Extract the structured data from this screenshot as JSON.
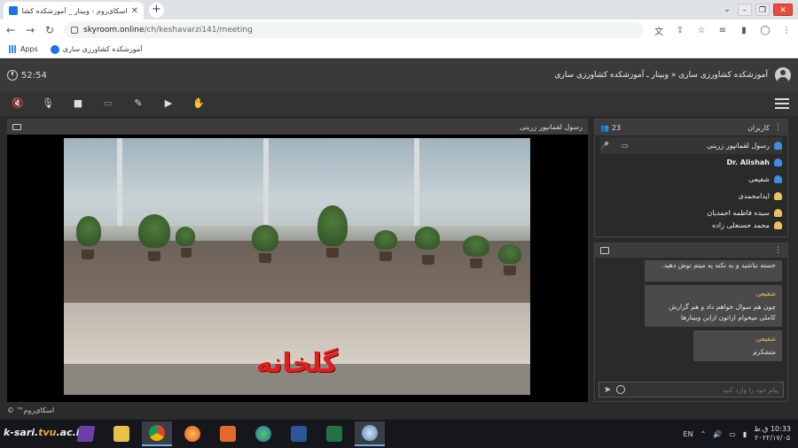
{
  "browser": {
    "tab_title": "اسکای‌روم - وبینار _ آموزشکده کشاورزی",
    "url_host": "skyroom.online",
    "url_path": "/ch/keshavarzi141/meeting",
    "bookmarks": [
      {
        "label": "Apps",
        "icon": "apps-grid-icon"
      },
      {
        "label": "آموزشکده کشاورزی ساری",
        "icon": "skyroom-icon"
      }
    ]
  },
  "meeting": {
    "timer": "52:54",
    "room_title": "آموزشکده کشاورزی ساری « وبینار ـ آموزشکده کشاورزی ساری",
    "toolbar": [
      {
        "name": "speaker-mute-icon",
        "glyph": "🔇"
      },
      {
        "name": "mic-off-icon",
        "glyph": "🎙"
      },
      {
        "name": "camera-icon",
        "glyph": "■"
      },
      {
        "name": "screen-share-icon",
        "glyph": "▭"
      },
      {
        "name": "brush-icon",
        "glyph": "✎"
      },
      {
        "name": "play-media-icon",
        "glyph": "▶"
      },
      {
        "name": "raise-hand-icon",
        "glyph": "✋"
      }
    ]
  },
  "video": {
    "speaker": "رسول لقمانپور زرینی",
    "caption": "گلخانه"
  },
  "users": {
    "label": "کاربران",
    "count": "23",
    "list": [
      {
        "name": "رسول لقمانپور زرینی",
        "color": "#3d8ee0",
        "active": true
      },
      {
        "name": "Dr. Alishah",
        "color": "#3d8ee0"
      },
      {
        "name": "شفیعی",
        "color": "#3d8ee0"
      },
      {
        "name": "ایدامحمدی",
        "color": "#e8c25c"
      },
      {
        "name": "سیده فاطمه احمدیان",
        "color": "#e8c25c"
      },
      {
        "name": "محمد حسنعلی زاده",
        "color": "#e8c25c"
      }
    ]
  },
  "chat": {
    "messages": [
      {
        "author": "",
        "text": "خسته نباشید و به نکته یه میتم توش دهید."
      },
      {
        "author": "شفیعی",
        "text": "چون هم سوال خواهم داد و هم گزارش کاملی میخوام ازاتون ازاین وبینارها"
      },
      {
        "author": "شفیعی",
        "text": "متشکرم"
      }
    ],
    "placeholder": "پیام خود را وارد کنید"
  },
  "brand": "اسکای‌روم™ ©",
  "watermark": {
    "prefix": "k-sari.",
    "accent": "tvu",
    "suffix": ".ac.ir"
  },
  "taskbar": {
    "lang": "EN",
    "time": "10:33 ق.ظ",
    "date": "۲۰۲۲/۱۷/۰۵"
  }
}
